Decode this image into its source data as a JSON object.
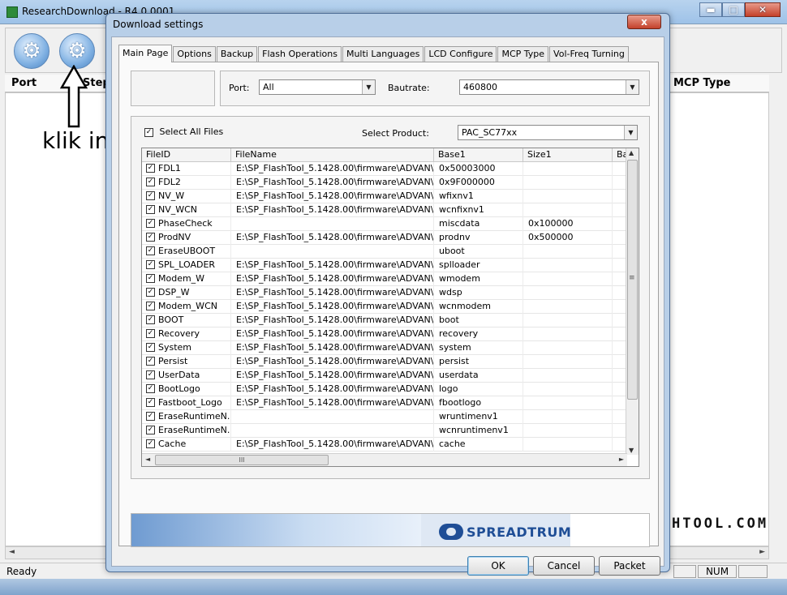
{
  "main": {
    "title": "ResearchDownload - R4.0.0001",
    "columns": {
      "port": "Port",
      "step": "Step",
      "mcp_type": "MCP Type"
    },
    "status_ready": "Ready",
    "status_num": "NUM",
    "watermark": "HTOOL.COM"
  },
  "annotation": {
    "text": "klik ini"
  },
  "dialog": {
    "title": "Download settings",
    "close_label": "x",
    "tabs": [
      {
        "label": "Main Page"
      },
      {
        "label": "Options"
      },
      {
        "label": "Backup"
      },
      {
        "label": "Flash Operations"
      },
      {
        "label": "Multi Languages"
      },
      {
        "label": "LCD Configure"
      },
      {
        "label": "MCP Type"
      },
      {
        "label": "Vol-Freq Turning"
      }
    ],
    "port_label": "Port:",
    "port_value": "All",
    "baudrate_label": "Bautrate:",
    "baudrate_value": "460800",
    "select_all_label": "Select All Files",
    "select_product_label": "Select Product:",
    "product_value": "PAC_SC77xx",
    "list_columns": {
      "file_id": "FileID",
      "file_name": "FileName",
      "base1": "Base1",
      "size1": "Size1",
      "ba": "Ba"
    },
    "files": [
      {
        "id": "FDL1",
        "name": "E:\\SP_FlashTool_5.1428.00\\firmware\\ADVAN\\...",
        "base": "0x50003000",
        "size": ""
      },
      {
        "id": "FDL2",
        "name": "E:\\SP_FlashTool_5.1428.00\\firmware\\ADVAN\\...",
        "base": "0x9F000000",
        "size": ""
      },
      {
        "id": "NV_W",
        "name": "E:\\SP_FlashTool_5.1428.00\\firmware\\ADVAN\\...",
        "base": "wfixnv1",
        "size": ""
      },
      {
        "id": "NV_WCN",
        "name": "E:\\SP_FlashTool_5.1428.00\\firmware\\ADVAN\\...",
        "base": "wcnfixnv1",
        "size": ""
      },
      {
        "id": "PhaseCheck",
        "name": "",
        "base": "miscdata",
        "size": "0x100000"
      },
      {
        "id": "ProdNV",
        "name": "E:\\SP_FlashTool_5.1428.00\\firmware\\ADVAN\\...",
        "base": "prodnv",
        "size": "0x500000"
      },
      {
        "id": "EraseUBOOT",
        "name": "",
        "base": "uboot",
        "size": ""
      },
      {
        "id": "SPL_LOADER",
        "name": "E:\\SP_FlashTool_5.1428.00\\firmware\\ADVAN\\...",
        "base": "splloader",
        "size": ""
      },
      {
        "id": "Modem_W",
        "name": "E:\\SP_FlashTool_5.1428.00\\firmware\\ADVAN\\...",
        "base": "wmodem",
        "size": ""
      },
      {
        "id": "DSP_W",
        "name": "E:\\SP_FlashTool_5.1428.00\\firmware\\ADVAN\\...",
        "base": "wdsp",
        "size": ""
      },
      {
        "id": "Modem_WCN",
        "name": "E:\\SP_FlashTool_5.1428.00\\firmware\\ADVAN\\...",
        "base": "wcnmodem",
        "size": ""
      },
      {
        "id": "BOOT",
        "name": "E:\\SP_FlashTool_5.1428.00\\firmware\\ADVAN\\...",
        "base": "boot",
        "size": ""
      },
      {
        "id": "Recovery",
        "name": "E:\\SP_FlashTool_5.1428.00\\firmware\\ADVAN\\...",
        "base": "recovery",
        "size": ""
      },
      {
        "id": "System",
        "name": "E:\\SP_FlashTool_5.1428.00\\firmware\\ADVAN\\...",
        "base": "system",
        "size": ""
      },
      {
        "id": "Persist",
        "name": "E:\\SP_FlashTool_5.1428.00\\firmware\\ADVAN\\...",
        "base": "persist",
        "size": ""
      },
      {
        "id": "UserData",
        "name": "E:\\SP_FlashTool_5.1428.00\\firmware\\ADVAN\\...",
        "base": "userdata",
        "size": ""
      },
      {
        "id": "BootLogo",
        "name": "E:\\SP_FlashTool_5.1428.00\\firmware\\ADVAN\\...",
        "base": "logo",
        "size": ""
      },
      {
        "id": "Fastboot_Logo",
        "name": "E:\\SP_FlashTool_5.1428.00\\firmware\\ADVAN\\...",
        "base": "fbootlogo",
        "size": ""
      },
      {
        "id": "EraseRuntimeN...",
        "name": "",
        "base": "wruntimenv1",
        "size": ""
      },
      {
        "id": "EraseRuntimeN...",
        "name": "",
        "base": "wcnruntimenv1",
        "size": ""
      },
      {
        "id": "Cache",
        "name": "E:\\SP_FlashTool_5.1428.00\\firmware\\ADVAN\\...",
        "base": "cache",
        "size": ""
      }
    ],
    "hscroll_grip": "III",
    "vscroll_grip": "≡",
    "logo_text": "SPREADTRUM",
    "buttons": {
      "ok": "OK",
      "cancel": "Cancel",
      "packet": "Packet"
    }
  },
  "icons": {
    "toolbar_1": "settings-gear-icon",
    "toolbar_2": "load-packet-gears-icon",
    "checkbox": "checkmark-icon",
    "dropdown": "chevron-down-icon"
  },
  "colors": {
    "title_bar": "#9ec2e8",
    "close_button": "#c4402a",
    "brand_blue": "#1f4e96"
  }
}
